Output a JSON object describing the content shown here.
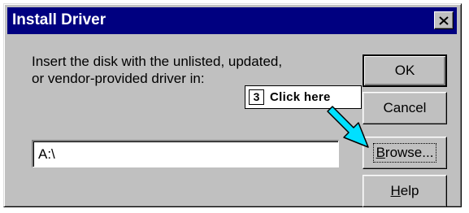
{
  "window": {
    "title": "Install Driver"
  },
  "message": {
    "line1": "Insert the disk with the unlisted, updated,",
    "line2": "or vendor-provided driver in:"
  },
  "path_input": {
    "value": "A:\\"
  },
  "buttons": {
    "ok": "OK",
    "cancel": "Cancel",
    "browse_mnemonic": "B",
    "browse_rest": "rowse...",
    "help_mnemonic": "H",
    "help_rest": "elp"
  },
  "callout": {
    "step": "3",
    "text": "Click here"
  },
  "colors": {
    "titlebar": "#000080",
    "face": "#c0c0c0",
    "arrow": "#00e0ff"
  },
  "icons": {
    "close": "close-icon",
    "pointer": "arrow-pointer-icon"
  }
}
